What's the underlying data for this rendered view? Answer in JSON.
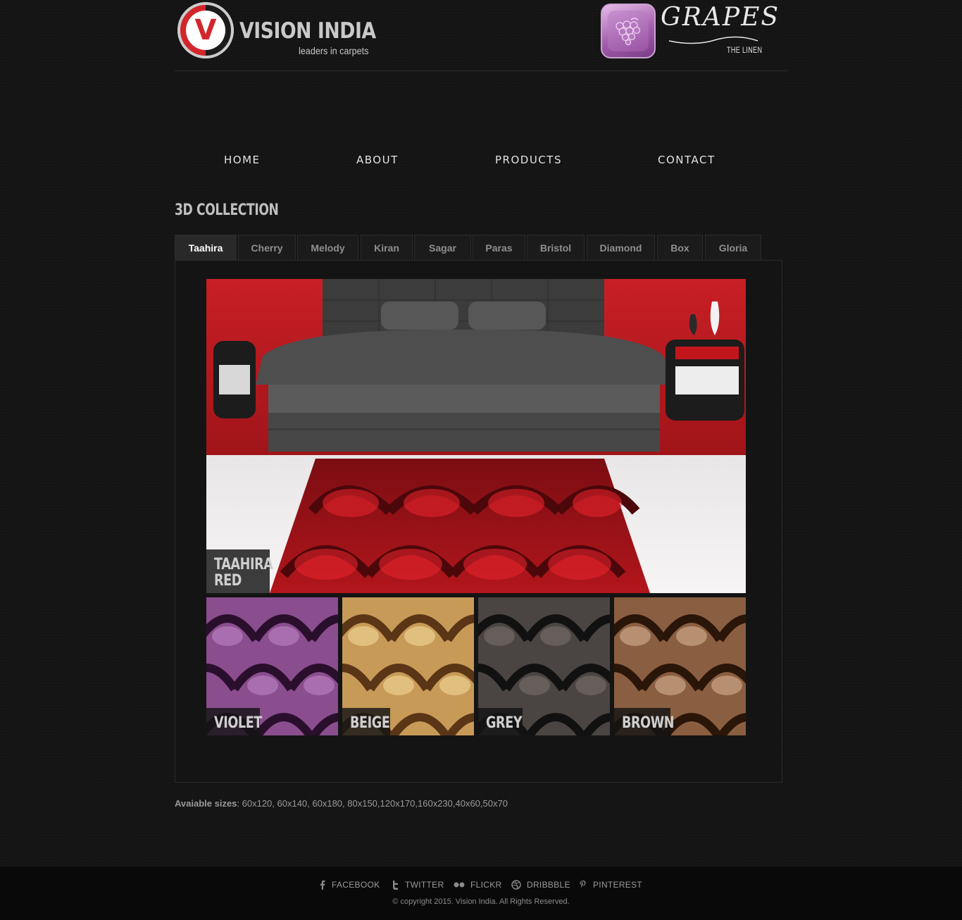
{
  "header": {
    "brand_mark": "V",
    "brand_name": "VISION INDIA",
    "brand_tagline": "leaders in carpets",
    "partner_name": "GRAPES",
    "partner_tagline": "THE LINEN"
  },
  "nav": {
    "items": [
      "HOME",
      "ABOUT",
      "PRODUCTS",
      "CONTACT"
    ]
  },
  "section": {
    "title": "3D COLLECTION"
  },
  "tabs": {
    "items": [
      "Taahira",
      "Cherry",
      "Melody",
      "Kiran",
      "Sagar",
      "Paras",
      "Bristol",
      "Diamond",
      "Box",
      "Gloria"
    ],
    "active": "Taahira"
  },
  "hero": {
    "caption_line1": "TAAHIRA",
    "caption_line2": "RED"
  },
  "variants": {
    "items": [
      {
        "label": "VIOLET",
        "color": "#7a3f7e"
      },
      {
        "label": "BEIGE",
        "color": "#b88a4c"
      },
      {
        "label": "GREY",
        "color": "#3a3634"
      },
      {
        "label": "BROWN",
        "color": "#6e4a34"
      }
    ]
  },
  "sizes": {
    "label": "Avaiable sizes",
    "values": ": 60x120, 60x140, 60x180, 80x150,120x170,160x230,40x60,50x70"
  },
  "footer": {
    "social": [
      "FACEBOOK",
      "TWITTER",
      "FLICKR",
      "DRIBBBLE",
      "PINTEREST"
    ],
    "copyright": "© copyright 2015. Vision India. All Rights Reserved."
  }
}
